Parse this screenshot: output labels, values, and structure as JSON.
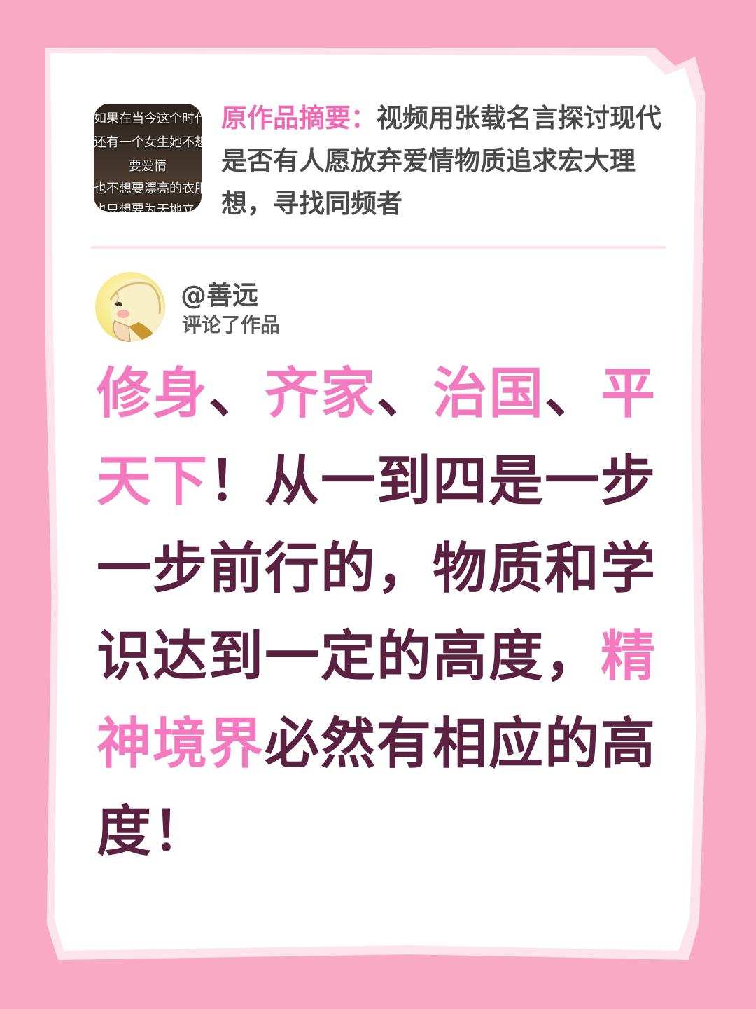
{
  "colors": {
    "background": "#f8a9c4",
    "paper": "#ffffff",
    "accent_pink": "#f47ac0",
    "label_pink": "#f067b3",
    "dark_text": "#5a2240",
    "gray_text": "#4a4a4a"
  },
  "thumbnail": {
    "lines": [
      "如果在当今这个时代",
      "还有一个女生她不想",
      "要爱情",
      "也不想要漂亮的衣服",
      "也只想要为天地立心"
    ]
  },
  "summary": {
    "label": "原作品摘要：",
    "text": "视频用张载名言探讨现代是否有人愿放弃爱情物质追求宏大理想，寻找同频者"
  },
  "author": {
    "name": "@善远",
    "action": "评论了作品",
    "avatar_icon": "cartoon-avatar-icon"
  },
  "comment": {
    "segments": [
      {
        "text": "修身",
        "highlight": true
      },
      {
        "text": "、",
        "highlight": false
      },
      {
        "text": "齐家",
        "highlight": true
      },
      {
        "text": "、",
        "highlight": false
      },
      {
        "text": "治国",
        "highlight": true
      },
      {
        "text": "、",
        "highlight": false
      },
      {
        "text": "平天下",
        "highlight": true
      },
      {
        "text": "！从一到四是一步一步前行的，物质和学识达到一定的高度，",
        "highlight": false
      },
      {
        "text": "精神境界",
        "highlight": true
      },
      {
        "text": "必然有相应的高度！",
        "highlight": false
      }
    ]
  }
}
